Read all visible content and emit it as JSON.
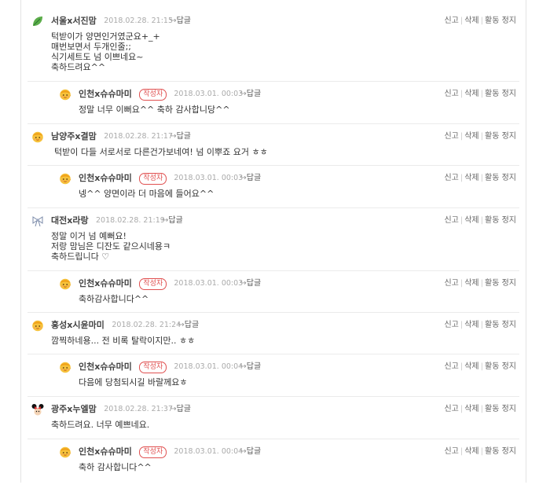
{
  "actions": {
    "report": "신고",
    "delete": "삭제",
    "block": "활동 정지",
    "reply": "답글",
    "author_badge": "작성자"
  },
  "comments": [
    {
      "nick": "서울x서진맘",
      "date": "2018.02.28. 21:15",
      "avatar": "leaf-icon",
      "lines": [
        "턱받이가 양면인거였군요+_+",
        "매번보면서 두개인줄;;",
        "식기세트도 넘 이쁘네요~",
        "축하드려요^^"
      ]
    },
    {
      "nick": "인천x슈슈마미",
      "date": "2018.03.01. 00:03",
      "avatar": "mascot-icon",
      "reply": true,
      "lines": [
        "정말 너무 이뻐요^^ 축하 감사합니당^^"
      ]
    },
    {
      "nick": "남양주x결맘",
      "date": "2018.02.28. 21:17",
      "avatar": "mascot-icon",
      "lines": [
        "턱받이 다들 서로서로 다른건가보네여! 넘 이뿌죠 요거 ㅎㅎ"
      ]
    },
    {
      "nick": "인천x슈슈마미",
      "date": "2018.03.01. 00:03",
      "avatar": "mascot-icon",
      "reply": true,
      "lines": [
        "넹^^ 양면이라 더 마음에 들어요^^"
      ]
    },
    {
      "nick": "대전x라랑",
      "date": "2018.02.28. 21:19",
      "avatar": "ribbon-icon",
      "lines": [
        "정말 이거 넘 예뻐요!",
        "저랑 맘님은 디잔도 같으시네용ㅋ",
        "축하드립니다 ♡"
      ]
    },
    {
      "nick": "인천x슈슈마미",
      "date": "2018.03.01. 00:03",
      "avatar": "mascot-icon",
      "reply": true,
      "lines": [
        "축하감사합니다^^"
      ]
    },
    {
      "nick": "홍성x시윤마미",
      "date": "2018.02.28. 21:24",
      "avatar": "mascot-icon",
      "lines": [
        "깜찍하네용... 전 비록 탈락이지만.. ㅎㅎ"
      ]
    },
    {
      "nick": "인천x슈슈마미",
      "date": "2018.03.01. 00:04",
      "avatar": "mascot-icon",
      "reply": true,
      "lines": [
        "다음에 당첨되시길 바랄께요ㅎ"
      ]
    },
    {
      "nick": "광주x누엘맘",
      "date": "2018.02.28. 21:37",
      "avatar": "minnie-icon",
      "lines": [
        "축하드려요. 너무 예쁘네요."
      ]
    },
    {
      "nick": "인천x슈슈마미",
      "date": "2018.03.01. 00:04",
      "avatar": "mascot-icon",
      "reply": true,
      "lines": [
        "축하 감사합니다^^"
      ]
    }
  ]
}
